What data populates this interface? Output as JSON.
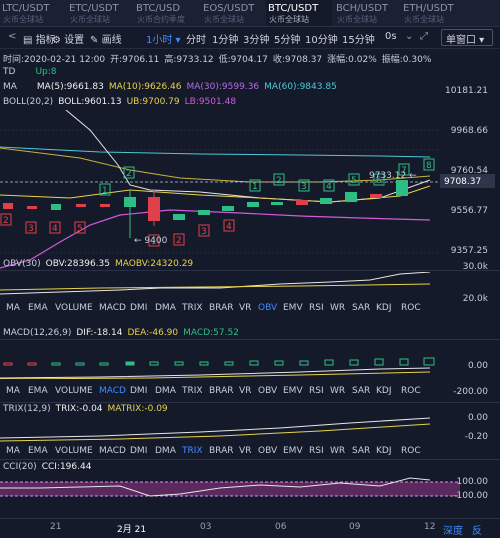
{
  "tabs": [
    {
      "name": "LTC/USDT",
      "sub": "火币全球站"
    },
    {
      "name": "ETC/USDT",
      "sub": "火币全球站"
    },
    {
      "name": "BTC/USD",
      "sub": "火币合约季度"
    },
    {
      "name": "EOS/USDT",
      "sub": "火币全球站"
    },
    {
      "name": "BTC/USDT",
      "sub": "火币全球站"
    },
    {
      "name": "BCH/USDT",
      "sub": "火币全球站"
    },
    {
      "name": "ETH/USDT",
      "sub": "火币全球站"
    }
  ],
  "toolbar": {
    "indicator": "指标",
    "settings": "设置",
    "draw": "画线",
    "periods": [
      "1小时 ▾",
      "分时",
      "1分钟",
      "3分钟",
      "5分钟",
      "10分钟",
      "15分钟",
      "0s"
    ],
    "window_mode": "单窗口 ▾"
  },
  "info": {
    "time": "时间:2020-02-21 12:00",
    "open": "开:9706.11",
    "high": "高:9733.12",
    "low": "低:9704.17",
    "close": "收:9708.37",
    "change": "涨幅:0.02%",
    "amplitude": "振幅:0.30%"
  },
  "td": {
    "label": "TD",
    "value": "Up:8"
  },
  "ma": {
    "label": "MA",
    "ma5": "MA(5):9661.83",
    "ma10": "MA(10):9626.46",
    "ma30": "MA(30):9599.36",
    "ma60": "MA(60):9843.85"
  },
  "boll": {
    "label": "BOLL(20,2)",
    "boll": "BOLL:9601.13",
    "ub": "UB:9700.79",
    "lb": "LB:9501.48"
  },
  "main_axis": [
    "10181.21",
    "9968.66",
    "9760.54",
    "9556.77",
    "9357.25"
  ],
  "current_price": "9708.37",
  "high_mark": "9733.12 ←",
  "low_mark": "← 9400",
  "obv": {
    "label": "OBV(30)",
    "obv": "OBV:28396.35",
    "maobv": "MAOBV:24320.29",
    "axis": [
      "30.0k",
      "20.0k"
    ]
  },
  "macd": {
    "label": "MACD(12,26,9)",
    "dif": "DIF:-18.14",
    "dea": "DEA:-46.90",
    "macd": "MACD:57.52",
    "axis": [
      "0.00",
      "-200.00"
    ]
  },
  "trix": {
    "label": "TRIX(12,9)",
    "trix": "TRIX:-0.04",
    "matrix": "MATRIX:-0.09",
    "axis": [
      "0.00",
      "-0.20"
    ]
  },
  "cci": {
    "label": "CCI(20)",
    "cci": "CCI:196.44",
    "axis": [
      "100.00",
      "-100.00"
    ]
  },
  "indicator_tabs": [
    "MA",
    "EMA",
    "VOLUME",
    "MACD",
    "DMI",
    "DMA",
    "TRIX",
    "BRAR",
    "VR",
    "OBV",
    "EMV",
    "RSI",
    "WR",
    "SAR",
    "KDJ",
    "ROC"
  ],
  "x_axis": [
    "21",
    "2月 21",
    "03",
    "06",
    "09",
    "12"
  ],
  "footer": {
    "depth": "深度",
    "reverse": "反",
    "label12": "12"
  },
  "colors": {
    "up": "#2ebd85",
    "down": "#e0404b",
    "accent": "#3d8cff",
    "ma5": "#f0f0f0",
    "ma10": "#e8d24a",
    "ma30": "#b26de0",
    "ma60": "#4bc9d6"
  }
}
